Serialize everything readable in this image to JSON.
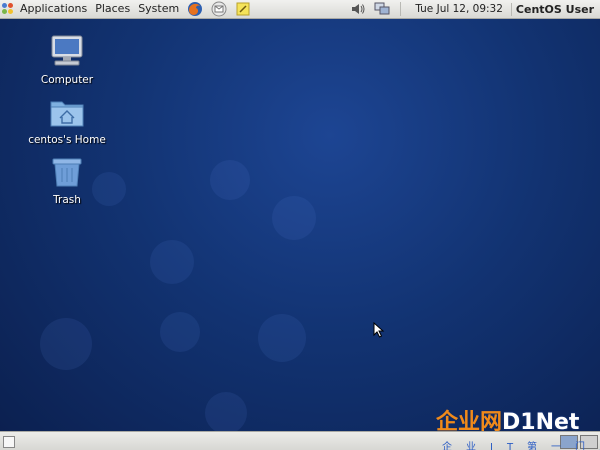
{
  "top_panel": {
    "menus": {
      "applications": "Applications",
      "places": "Places",
      "system": "System"
    },
    "launchers": [
      "firefox-icon",
      "mail-icon",
      "notes-icon"
    ],
    "tray": [
      "volume-icon",
      "network-icon"
    ],
    "clock": "Tue Jul 12, 09:32",
    "user": "CentOS User"
  },
  "desktop": {
    "icons": [
      {
        "label": "Computer",
        "icon": "computer-icon"
      },
      {
        "label": "centos's Home",
        "icon": "home-folder-icon"
      },
      {
        "label": "Trash",
        "icon": "trash-icon"
      }
    ]
  },
  "watermark": {
    "cn": "企业网",
    "en": "D1Net",
    "sub": "企业IT第一门户"
  },
  "colors": {
    "desktop_bg": "#123372",
    "panel_bg": "#e4e4e1",
    "watermark_orange": "#f08a1a",
    "watermark_blue": "#2a5cc4"
  }
}
